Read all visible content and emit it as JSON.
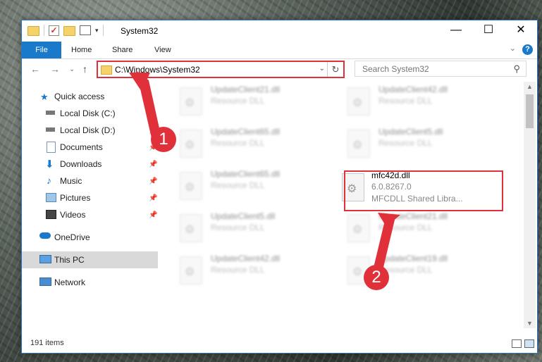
{
  "window": {
    "title": "System32",
    "controls": [
      "—",
      "☐",
      "✕"
    ]
  },
  "ribbon": {
    "file": "File",
    "tabs": [
      "Home",
      "Share",
      "View"
    ]
  },
  "address": {
    "path": "C:\\Windows\\System32"
  },
  "search": {
    "placeholder": "Search System32"
  },
  "sidebar": {
    "items": [
      {
        "label": "Quick access",
        "icon": "star-icon"
      },
      {
        "label": "Local Disk (C:)",
        "icon": "drive-icon"
      },
      {
        "label": "Local Disk (D:)",
        "icon": "drive-icon"
      },
      {
        "label": "Documents",
        "icon": "documents-icon"
      },
      {
        "label": "Downloads",
        "icon": "download-icon"
      },
      {
        "label": "Music",
        "icon": "music-icon"
      },
      {
        "label": "Pictures",
        "icon": "pictures-icon"
      },
      {
        "label": "Videos",
        "icon": "videos-icon"
      },
      {
        "label": "OneDrive",
        "icon": "cloud-icon"
      },
      {
        "label": "This PC",
        "icon": "pc-icon"
      },
      {
        "label": "Network",
        "icon": "network-icon"
      }
    ]
  },
  "files": [
    {
      "name": "UpdateClient21.dll",
      "sub": "Resource DLL"
    },
    {
      "name": "UpdateClient42.dll",
      "sub": "Resource DLL"
    },
    {
      "name": "UpdateClient65.dll",
      "sub": "Resource DLL"
    },
    {
      "name": "UpdateClient5.dll",
      "sub": "Resource DLL"
    },
    {
      "name": "UpdateClient65.dll",
      "sub": "Resource DLL"
    },
    {
      "name": "mfc42d.dll",
      "sub": "6.0.8267.0",
      "sub2": "MFCDLL Shared Libra..."
    },
    {
      "name": "UpdateClient5.dll",
      "sub": "Resource DLL"
    },
    {
      "name": "UpdateClient21.dll",
      "sub": "Resource DLL"
    },
    {
      "name": "UpdateClient42.dll",
      "sub": "Resource DLL"
    },
    {
      "name": "UpdateClient19.dll",
      "sub": "Resource DLL"
    }
  ],
  "status": {
    "items": "191 items"
  },
  "callouts": [
    "1",
    "2"
  ],
  "accent": "#1979ca",
  "highlight": "#e0313b"
}
